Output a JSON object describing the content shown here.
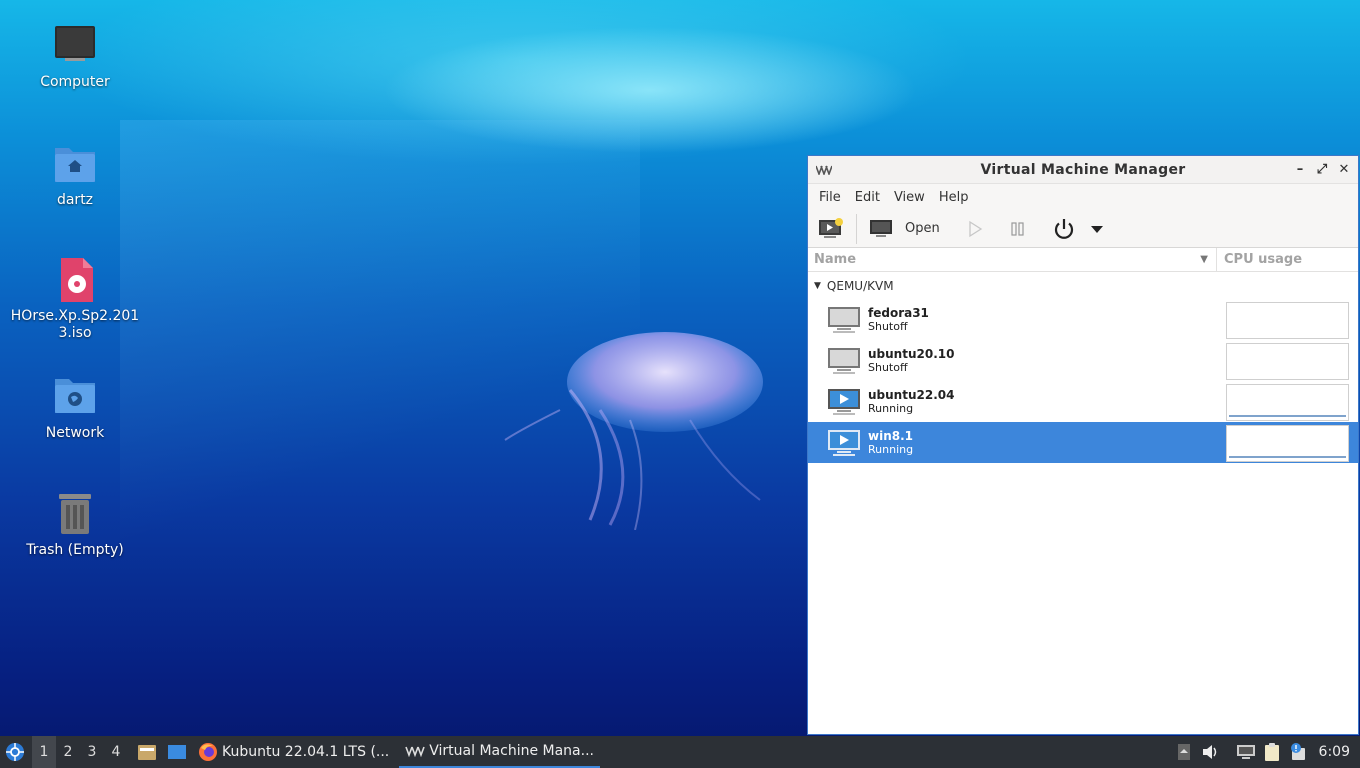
{
  "desktop": {
    "icons": [
      {
        "label": "Computer",
        "icon": "computer-icon"
      },
      {
        "label": "dartz",
        "icon": "home-folder-icon"
      },
      {
        "label": "HOrse.Xp.Sp2.2013.iso",
        "icon": "disc-image-icon"
      },
      {
        "label": "Network",
        "icon": "network-folder-icon"
      },
      {
        "label": "Trash (Empty)",
        "icon": "trash-icon"
      }
    ]
  },
  "window": {
    "title": "Virtual Machine Manager",
    "controls": {
      "minimize": "–",
      "maximize": "⤢",
      "close": "✕"
    },
    "menu": [
      "File",
      "Edit",
      "View",
      "Help"
    ],
    "toolbar": {
      "open_label": "Open"
    },
    "columns": {
      "name": "Name",
      "cpu": "CPU usage"
    },
    "group": "QEMU/KVM",
    "vms": [
      {
        "name": "fedora31",
        "status": "Shutoff",
        "running": false
      },
      {
        "name": "ubuntu20.10",
        "status": "Shutoff",
        "running": false
      },
      {
        "name": "ubuntu22.04",
        "status": "Running",
        "running": true
      },
      {
        "name": "win8.1",
        "status": "Running",
        "running": true,
        "selected": true
      }
    ]
  },
  "taskbar": {
    "workspaces": [
      "1",
      "2",
      "3",
      "4"
    ],
    "active_workspace": "1",
    "tasks": [
      {
        "label": "Kubuntu 22.04.1 LTS (...",
        "icon": "firefox-icon"
      },
      {
        "label": "Virtual Machine Mana...",
        "icon": "vmm-icon"
      }
    ],
    "clock": "6:09"
  },
  "colors": {
    "accent": "#3d86db",
    "taskbar": "#2c3036"
  }
}
